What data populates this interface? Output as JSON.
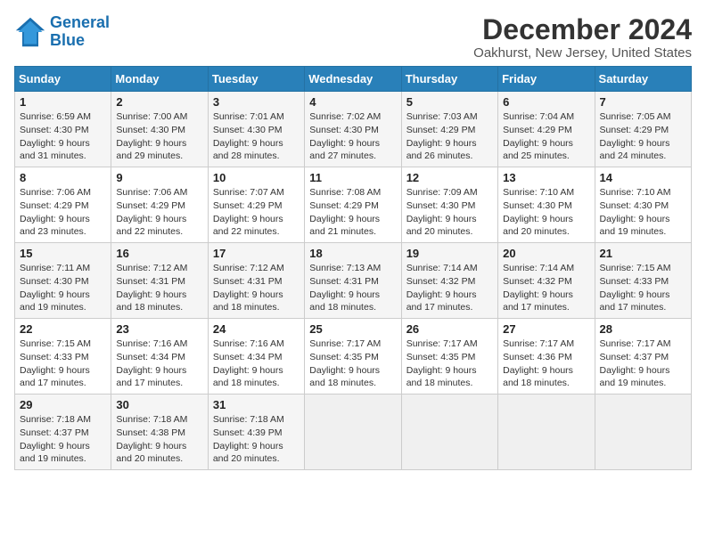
{
  "logo": {
    "line1": "General",
    "line2": "Blue"
  },
  "title": "December 2024",
  "subtitle": "Oakhurst, New Jersey, United States",
  "days_of_week": [
    "Sunday",
    "Monday",
    "Tuesday",
    "Wednesday",
    "Thursday",
    "Friday",
    "Saturday"
  ],
  "weeks": [
    [
      {
        "day": 1,
        "sunrise": "6:59 AM",
        "sunset": "4:30 PM",
        "daylight": "9 hours and 31 minutes."
      },
      {
        "day": 2,
        "sunrise": "7:00 AM",
        "sunset": "4:30 PM",
        "daylight": "9 hours and 29 minutes."
      },
      {
        "day": 3,
        "sunrise": "7:01 AM",
        "sunset": "4:30 PM",
        "daylight": "9 hours and 28 minutes."
      },
      {
        "day": 4,
        "sunrise": "7:02 AM",
        "sunset": "4:30 PM",
        "daylight": "9 hours and 27 minutes."
      },
      {
        "day": 5,
        "sunrise": "7:03 AM",
        "sunset": "4:29 PM",
        "daylight": "9 hours and 26 minutes."
      },
      {
        "day": 6,
        "sunrise": "7:04 AM",
        "sunset": "4:29 PM",
        "daylight": "9 hours and 25 minutes."
      },
      {
        "day": 7,
        "sunrise": "7:05 AM",
        "sunset": "4:29 PM",
        "daylight": "9 hours and 24 minutes."
      }
    ],
    [
      {
        "day": 8,
        "sunrise": "7:06 AM",
        "sunset": "4:29 PM",
        "daylight": "9 hours and 23 minutes."
      },
      {
        "day": 9,
        "sunrise": "7:06 AM",
        "sunset": "4:29 PM",
        "daylight": "9 hours and 22 minutes."
      },
      {
        "day": 10,
        "sunrise": "7:07 AM",
        "sunset": "4:29 PM",
        "daylight": "9 hours and 22 minutes."
      },
      {
        "day": 11,
        "sunrise": "7:08 AM",
        "sunset": "4:29 PM",
        "daylight": "9 hours and 21 minutes."
      },
      {
        "day": 12,
        "sunrise": "7:09 AM",
        "sunset": "4:30 PM",
        "daylight": "9 hours and 20 minutes."
      },
      {
        "day": 13,
        "sunrise": "7:10 AM",
        "sunset": "4:30 PM",
        "daylight": "9 hours and 20 minutes."
      },
      {
        "day": 14,
        "sunrise": "7:10 AM",
        "sunset": "4:30 PM",
        "daylight": "9 hours and 19 minutes."
      }
    ],
    [
      {
        "day": 15,
        "sunrise": "7:11 AM",
        "sunset": "4:30 PM",
        "daylight": "9 hours and 19 minutes."
      },
      {
        "day": 16,
        "sunrise": "7:12 AM",
        "sunset": "4:31 PM",
        "daylight": "9 hours and 18 minutes."
      },
      {
        "day": 17,
        "sunrise": "7:12 AM",
        "sunset": "4:31 PM",
        "daylight": "9 hours and 18 minutes."
      },
      {
        "day": 18,
        "sunrise": "7:13 AM",
        "sunset": "4:31 PM",
        "daylight": "9 hours and 18 minutes."
      },
      {
        "day": 19,
        "sunrise": "7:14 AM",
        "sunset": "4:32 PM",
        "daylight": "9 hours and 17 minutes."
      },
      {
        "day": 20,
        "sunrise": "7:14 AM",
        "sunset": "4:32 PM",
        "daylight": "9 hours and 17 minutes."
      },
      {
        "day": 21,
        "sunrise": "7:15 AM",
        "sunset": "4:33 PM",
        "daylight": "9 hours and 17 minutes."
      }
    ],
    [
      {
        "day": 22,
        "sunrise": "7:15 AM",
        "sunset": "4:33 PM",
        "daylight": "9 hours and 17 minutes."
      },
      {
        "day": 23,
        "sunrise": "7:16 AM",
        "sunset": "4:34 PM",
        "daylight": "9 hours and 17 minutes."
      },
      {
        "day": 24,
        "sunrise": "7:16 AM",
        "sunset": "4:34 PM",
        "daylight": "9 hours and 18 minutes."
      },
      {
        "day": 25,
        "sunrise": "7:17 AM",
        "sunset": "4:35 PM",
        "daylight": "9 hours and 18 minutes."
      },
      {
        "day": 26,
        "sunrise": "7:17 AM",
        "sunset": "4:35 PM",
        "daylight": "9 hours and 18 minutes."
      },
      {
        "day": 27,
        "sunrise": "7:17 AM",
        "sunset": "4:36 PM",
        "daylight": "9 hours and 18 minutes."
      },
      {
        "day": 28,
        "sunrise": "7:17 AM",
        "sunset": "4:37 PM",
        "daylight": "9 hours and 19 minutes."
      }
    ],
    [
      {
        "day": 29,
        "sunrise": "7:18 AM",
        "sunset": "4:37 PM",
        "daylight": "9 hours and 19 minutes."
      },
      {
        "day": 30,
        "sunrise": "7:18 AM",
        "sunset": "4:38 PM",
        "daylight": "9 hours and 20 minutes."
      },
      {
        "day": 31,
        "sunrise": "7:18 AM",
        "sunset": "4:39 PM",
        "daylight": "9 hours and 20 minutes."
      },
      null,
      null,
      null,
      null
    ]
  ]
}
